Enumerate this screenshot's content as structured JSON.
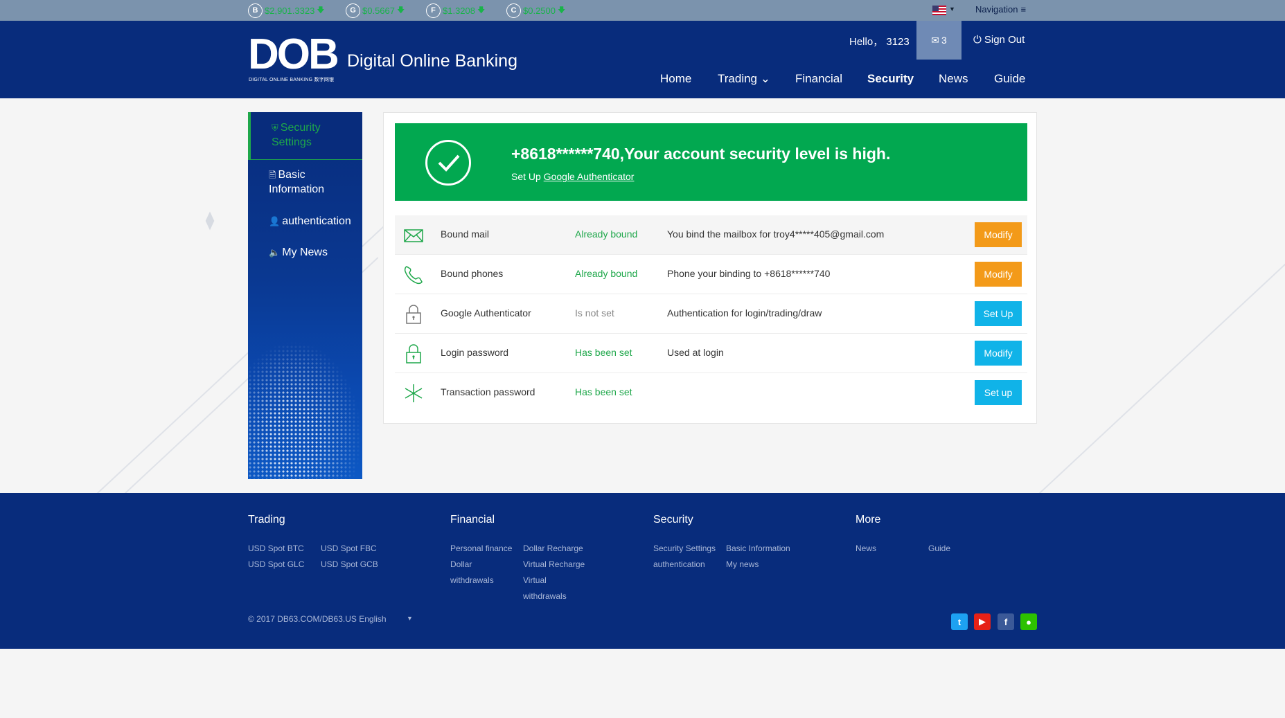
{
  "ticker": [
    {
      "symbol": "B",
      "price": "$2,901.3323",
      "icon": "bitcoin-icon"
    },
    {
      "symbol": "G",
      "price": "$0.5667",
      "icon": "coin-g-icon"
    },
    {
      "symbol": "F",
      "price": "$1.3208",
      "icon": "coin-f-icon"
    },
    {
      "symbol": "C",
      "price": "$0.2500",
      "icon": "coin-c-icon"
    }
  ],
  "top_nav": {
    "label": "Navigation"
  },
  "header": {
    "logo": "DOB",
    "logo_sub": "DIGITAL ONLINE BANKING 数字网银",
    "brand": "Digital Online Banking",
    "hello": "Hello， 3123",
    "mail_count": "3",
    "sign_out": "Sign Out"
  },
  "main_nav": [
    "Home",
    "Trading",
    "Financial",
    "Security",
    "News",
    "Guide"
  ],
  "sidebar": {
    "items": [
      "Security Settings",
      "Basic Information",
      "authentication",
      "My News"
    ]
  },
  "banner": {
    "title": "+8618******740,Your account security level is high.",
    "setup_prefix": "Set Up ",
    "setup_link": "Google Authenticator"
  },
  "security_rows": [
    {
      "name": "Bound mail",
      "status": "Already bound",
      "desc": "You bind the mailbox for troy4*****405@gmail.com",
      "button": "Modify"
    },
    {
      "name": "Bound phones",
      "status": "Already bound",
      "desc": "Phone your binding to +8618******740",
      "button": "Modify"
    },
    {
      "name": "Google Authenticator",
      "status": "Is not set",
      "desc": "Authentication for login/trading/draw",
      "button": "Set Up"
    },
    {
      "name": "Login password",
      "status": "Has been set",
      "desc": "Used at login",
      "button": "Modify"
    },
    {
      "name": "Transaction password",
      "status": "Has been set",
      "desc": "",
      "button": "Set up"
    }
  ],
  "footer": {
    "trading": {
      "heading": "Trading",
      "links": [
        "USD Spot BTC",
        "USD Spot FBC",
        "USD Spot GLC",
        "USD Spot GCB"
      ]
    },
    "financial": {
      "heading": "Financial",
      "links": [
        "Personal finance",
        "Dollar Recharge",
        "Dollar",
        "withdrawals",
        "Virtual Recharge",
        "Virtual",
        "withdrawals"
      ]
    },
    "security": {
      "heading": "Security",
      "links": [
        "Security Settings",
        "Basic Information",
        "authentication",
        "My news"
      ]
    },
    "more": {
      "heading": "More",
      "links": [
        "News",
        "Guide"
      ]
    },
    "copyright": "© 2017 DB63.COM/DB63.US English"
  },
  "colors": {
    "header_bg": "#082c7c",
    "ticker_bg": "#7b93ad",
    "accent_green": "#02a850",
    "button_orange": "#f39a19",
    "button_blue": "#10b3e8"
  }
}
